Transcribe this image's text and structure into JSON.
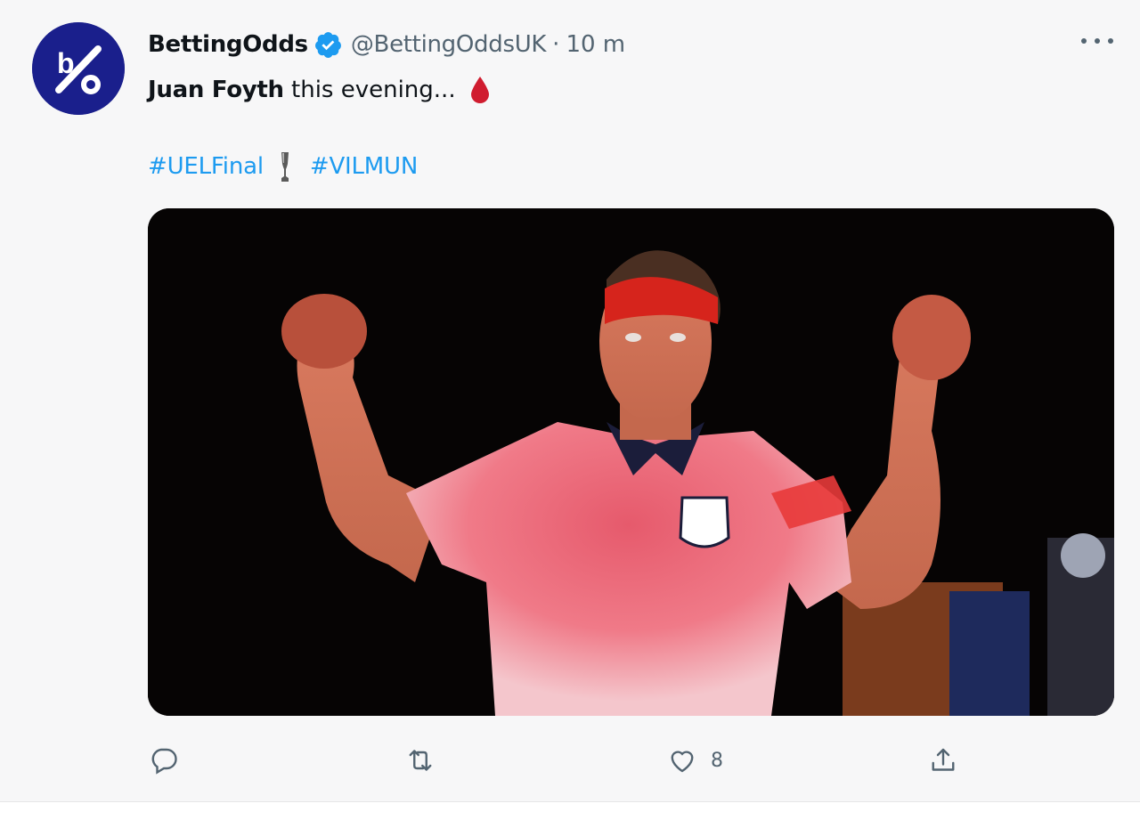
{
  "tweet": {
    "author": {
      "display_name": "BettingOdds",
      "verified": true,
      "handle": "@BettingOddsUK",
      "avatar_icon": "percent-logo-icon",
      "avatar_color": "#1a1f8c"
    },
    "separator": "·",
    "timestamp": "10 m",
    "text": {
      "bold": "Juan Foyth",
      "rest": " this evening...",
      "emoji_icon": "blood-drop-icon"
    },
    "hashtags": [
      "#UELFinal",
      "#VILMUN"
    ],
    "hashtag_emoji_icon": "trophy-icon",
    "accent_color": "#1d9bf0",
    "actions": {
      "reply": {
        "icon": "reply-icon",
        "count": ""
      },
      "retweet": {
        "icon": "retweet-icon",
        "count": ""
      },
      "like": {
        "icon": "heart-icon",
        "count": "8"
      },
      "share": {
        "icon": "share-icon",
        "count": ""
      }
    }
  }
}
